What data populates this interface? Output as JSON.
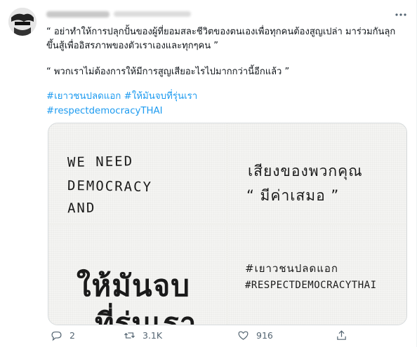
{
  "tweet": {
    "paragraph1": "“ อย่าทำให้การปลุกปั้นของผู้ที่ยอมสละชีวิตของตนเองเพื่อทุกคนต้องสูญเปล่า มาร่วมกันลุกขึ้นสู้เพื่ออิสรภาพของตัวเราเองและทุกๆคน ”",
    "paragraph2": "“ พวกเราไม่ต้องการให้มีการสูญเสียอะไรไปมากกว่านี้อีกแล้ว ”",
    "hashtags_line1": "#เยาวชนปลดแอก #ให้มันจบที่รุ่นเรา",
    "hashtags_line2": "#respectdemocracyTHAI"
  },
  "media": {
    "image1": {
      "line1": "WE NEED",
      "line2": "DEMOCRACY",
      "line3": "AND"
    },
    "image2": {
      "line1": "เสียงของพวกคุณ",
      "line2": "“ มีค่าเสมอ ”"
    },
    "image3": {
      "line1": "ให้มันจบ",
      "line2": "ที่รุ่นเรา"
    },
    "image4": {
      "line1": "#เยาวชนปลดแอก",
      "line2": "#RESPECTDEMOCRACYTHAI"
    }
  },
  "actions": {
    "reply_count": "2",
    "retweet_count": "3.1K",
    "like_count": "916"
  },
  "icons": [
    "avatar",
    "more-icon",
    "reply-icon",
    "retweet-icon",
    "like-icon",
    "share-icon"
  ],
  "colors": {
    "hashtag": "#1d9bf0",
    "icon_gray": "#536471"
  }
}
